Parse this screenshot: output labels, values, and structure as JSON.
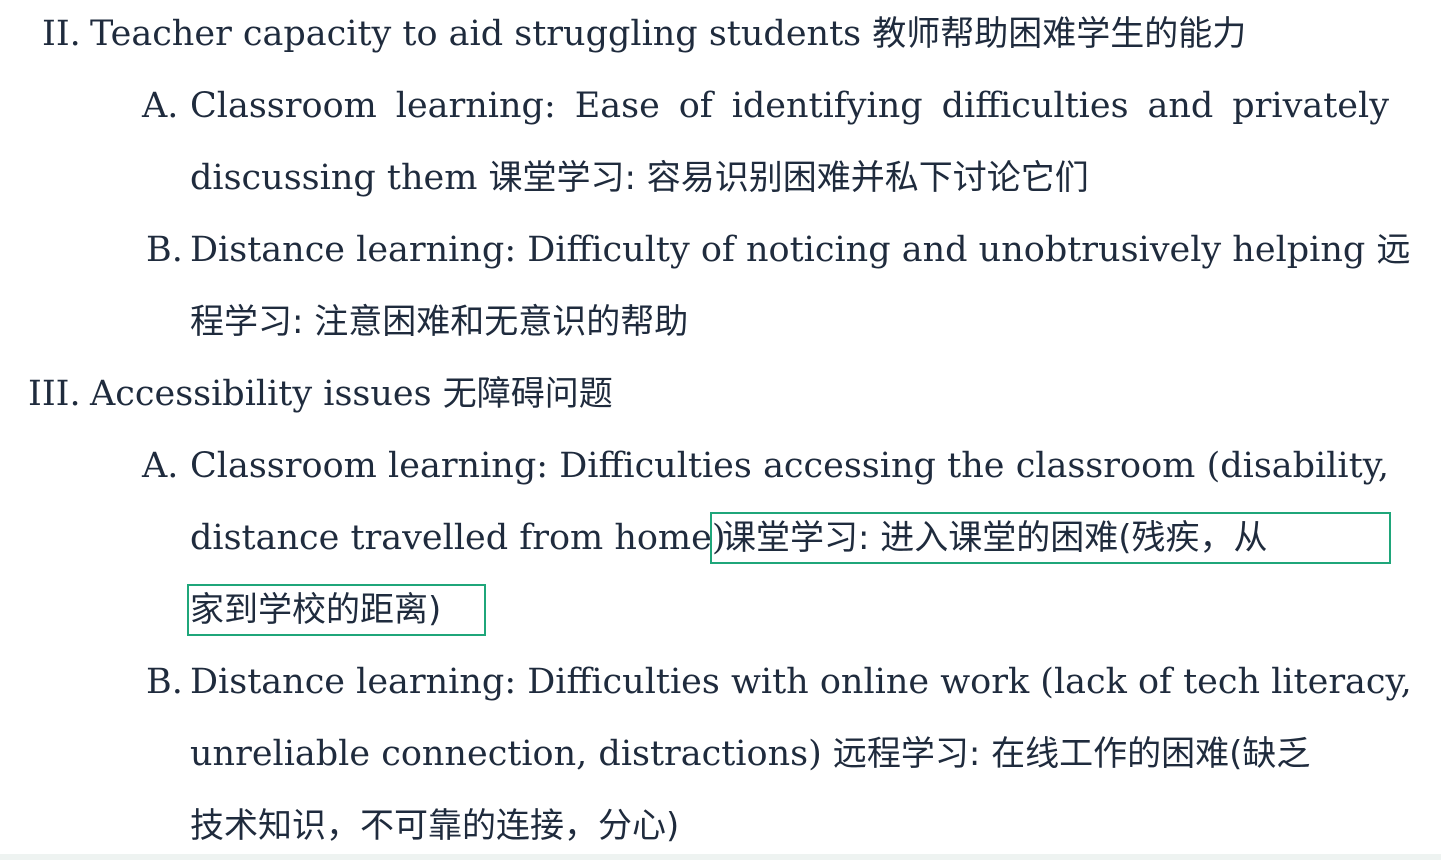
{
  "outline": {
    "section2": {
      "marker": "II.",
      "text_en": "Teacher capacity to aid struggling students",
      "text_zh": "教师帮助困难学生的能力",
      "itemA": {
        "marker": "A.",
        "line1_words": [
          "Classroom",
          "learning:",
          "Ease",
          "of",
          "identifying",
          "difficulties",
          "and",
          "privately"
        ],
        "line2_en": "discussing them",
        "line2_zh": "课堂学习: 容易识别困难并私下讨论它们"
      },
      "itemB": {
        "marker": "B.",
        "line1_en": "Distance learning: Difficulty of noticing and unobtrusively helping",
        "line1_zh": "远",
        "line2_zh": "程学习: 注意困难和无意识的帮助"
      }
    },
    "section3": {
      "marker": "III.",
      "text_en": "Accessibility issues",
      "text_zh": "无障碍问题",
      "itemA": {
        "marker": "A.",
        "line1_words": [
          "Classroom",
          "learning:",
          "Difficulties",
          "accessing",
          "the",
          "classroom",
          "(disability,"
        ],
        "line2_en": "distance travelled from home)",
        "line2_zh": "课堂学习: 进入课堂的困难(残疾，从",
        "line3_zh": "家到学校的距离)"
      },
      "itemB": {
        "marker": "B.",
        "line1_en": "Distance learning: Difficulties with online work (lack of tech literacy,",
        "line2_en": "unreliable connection, distractions)",
        "line2_zh": "远程学习: 在线工作的困难(缺乏",
        "line3_zh": "技术知识，不可靠的连接，分心)"
      }
    }
  },
  "colors": {
    "text": "#1f2b3d",
    "highlight_border": "#1fa67a"
  }
}
